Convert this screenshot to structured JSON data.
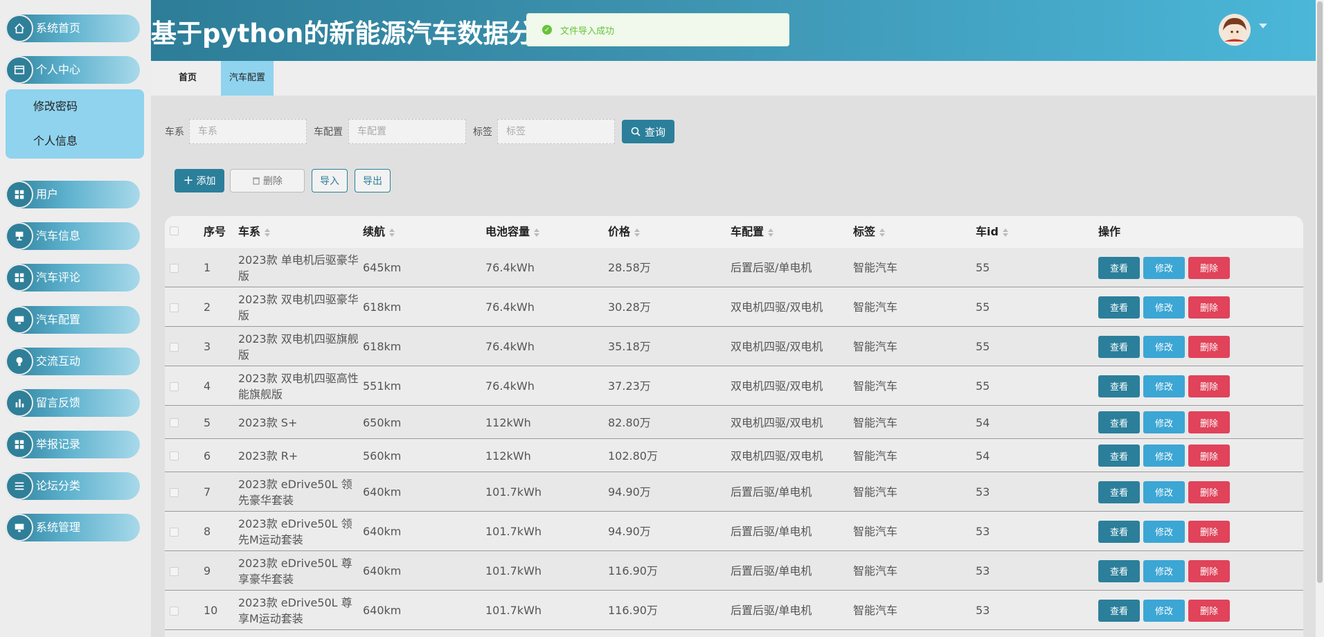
{
  "app": {
    "title": "基于python的新能源汽车数据分析"
  },
  "toast": {
    "message": "文件导入成功"
  },
  "sidebar": {
    "items": [
      {
        "label": "系统首页",
        "icon": "home-icon"
      },
      {
        "label": "个人中心",
        "icon": "window-icon"
      },
      {
        "label": "用户",
        "icon": "grid-icon"
      },
      {
        "label": "汽车信息",
        "icon": "cup-icon"
      },
      {
        "label": "汽车评论",
        "icon": "grid-icon"
      },
      {
        "label": "汽车配置",
        "icon": "monitor-icon"
      },
      {
        "label": "交流互动",
        "icon": "bulb-icon"
      },
      {
        "label": "留言反馈",
        "icon": "bar-chart-icon"
      },
      {
        "label": "举报记录",
        "icon": "grid-icon"
      },
      {
        "label": "论坛分类",
        "icon": "list-icon"
      },
      {
        "label": "系统管理",
        "icon": "monitor-icon"
      }
    ],
    "submenu": [
      {
        "label": "修改密码"
      },
      {
        "label": "个人信息"
      }
    ]
  },
  "tabs": [
    {
      "label": "首页",
      "active": false
    },
    {
      "label": "汽车配置",
      "active": true
    }
  ],
  "filters": {
    "series_label": "车系",
    "series_placeholder": "车系",
    "config_label": "车配置",
    "config_placeholder": "车配置",
    "tag_label": "标签",
    "tag_placeholder": "标签",
    "query_button": "查询"
  },
  "toolbar": {
    "add": "添加",
    "delete": "删除",
    "import": "导入",
    "export": "导出"
  },
  "table": {
    "columns": [
      "序号",
      "车系",
      "续航",
      "电池容量",
      "价格",
      "车配置",
      "标签",
      "车id",
      "操作"
    ],
    "actions": {
      "view": "查看",
      "edit": "修改",
      "delete": "删除"
    },
    "rows": [
      {
        "no": "1",
        "series": "2023款 单电机后驱豪华版",
        "range": "645km",
        "battery": "76.4kWh",
        "price": "28.58万",
        "config": "后置后驱/单电机",
        "tag": "智能汽车",
        "car_id": "55"
      },
      {
        "no": "2",
        "series": "2023款 双电机四驱豪华版",
        "range": "618km",
        "battery": "76.4kWh",
        "price": "30.28万",
        "config": "双电机四驱/双电机",
        "tag": "智能汽车",
        "car_id": "55"
      },
      {
        "no": "3",
        "series": "2023款 双电机四驱旗舰版",
        "range": "618km",
        "battery": "76.4kWh",
        "price": "35.18万",
        "config": "双电机四驱/双电机",
        "tag": "智能汽车",
        "car_id": "55"
      },
      {
        "no": "4",
        "series": "2023款 双电机四驱高性能旗舰版",
        "range": "551km",
        "battery": "76.4kWh",
        "price": "37.23万",
        "config": "双电机四驱/双电机",
        "tag": "智能汽车",
        "car_id": "55"
      },
      {
        "no": "5",
        "series": "2023款 S+",
        "range": "650km",
        "battery": "112kWh",
        "price": "82.80万",
        "config": "双电机四驱/双电机",
        "tag": "智能汽车",
        "car_id": "54"
      },
      {
        "no": "6",
        "series": "2023款 R+",
        "range": "560km",
        "battery": "112kWh",
        "price": "102.80万",
        "config": "双电机四驱/双电机",
        "tag": "智能汽车",
        "car_id": "54"
      },
      {
        "no": "7",
        "series": "2023款 eDrive50L 领先豪华套装",
        "range": "640km",
        "battery": "101.7kWh",
        "price": "94.90万",
        "config": "后置后驱/单电机",
        "tag": "智能汽车",
        "car_id": "53"
      },
      {
        "no": "8",
        "series": "2023款 eDrive50L 领先M运动套装",
        "range": "640km",
        "battery": "101.7kWh",
        "price": "94.90万",
        "config": "后置后驱/单电机",
        "tag": "智能汽车",
        "car_id": "53"
      },
      {
        "no": "9",
        "series": "2023款 eDrive50L 尊享豪华套装",
        "range": "640km",
        "battery": "101.7kWh",
        "price": "116.90万",
        "config": "后置后驱/单电机",
        "tag": "智能汽车",
        "car_id": "53"
      },
      {
        "no": "10",
        "series": "2023款 eDrive50L 尊享M运动套装",
        "range": "640km",
        "battery": "101.7kWh",
        "price": "116.90万",
        "config": "后置后驱/单电机",
        "tag": "智能汽车",
        "car_id": "53"
      }
    ]
  },
  "colors": {
    "primary": "#2b7f9a",
    "accent": "#3ca6d4",
    "danger": "#e0435a",
    "success": "#67c23a"
  }
}
